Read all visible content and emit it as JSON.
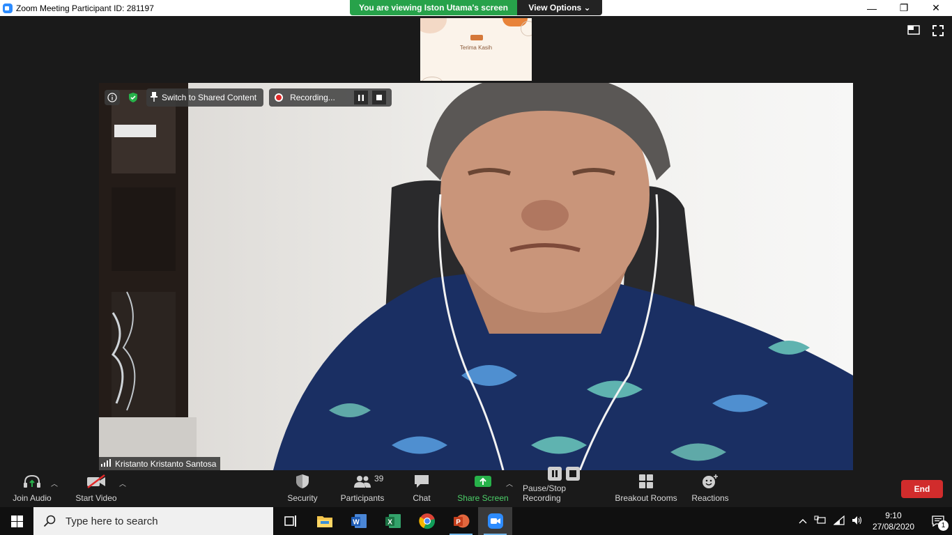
{
  "window": {
    "title": "Zoom Meeting Participant ID: 281197",
    "minimize": "—",
    "restore": "❐",
    "close": "✕"
  },
  "share_banner": {
    "viewing_text": "You are viewing Iston Utama's screen",
    "view_options": "View Options ⌄"
  },
  "thumbnail": {
    "text": "Terima Kasih"
  },
  "video_overlay": {
    "switch_label": "Switch to Shared Content",
    "recording_label": "Recording..."
  },
  "participant": {
    "name": "Kristanto Kristanto Santosa"
  },
  "toolbar": {
    "join_audio": "Join Audio",
    "start_video": "Start Video",
    "security": "Security",
    "participants": "Participants",
    "participants_count": "39",
    "chat": "Chat",
    "share_screen": "Share Screen",
    "pause_stop_recording": "Pause/Stop Recording",
    "breakout_rooms": "Breakout Rooms",
    "reactions": "Reactions",
    "end": "End"
  },
  "taskbar": {
    "search_placeholder": "Type here to search",
    "time": "9:10",
    "date": "27/08/2020",
    "notifications_count": "1"
  },
  "colors": {
    "share_green": "#27a24a",
    "end_red": "#d12c2c",
    "zoom_blue": "#2d8cff"
  }
}
